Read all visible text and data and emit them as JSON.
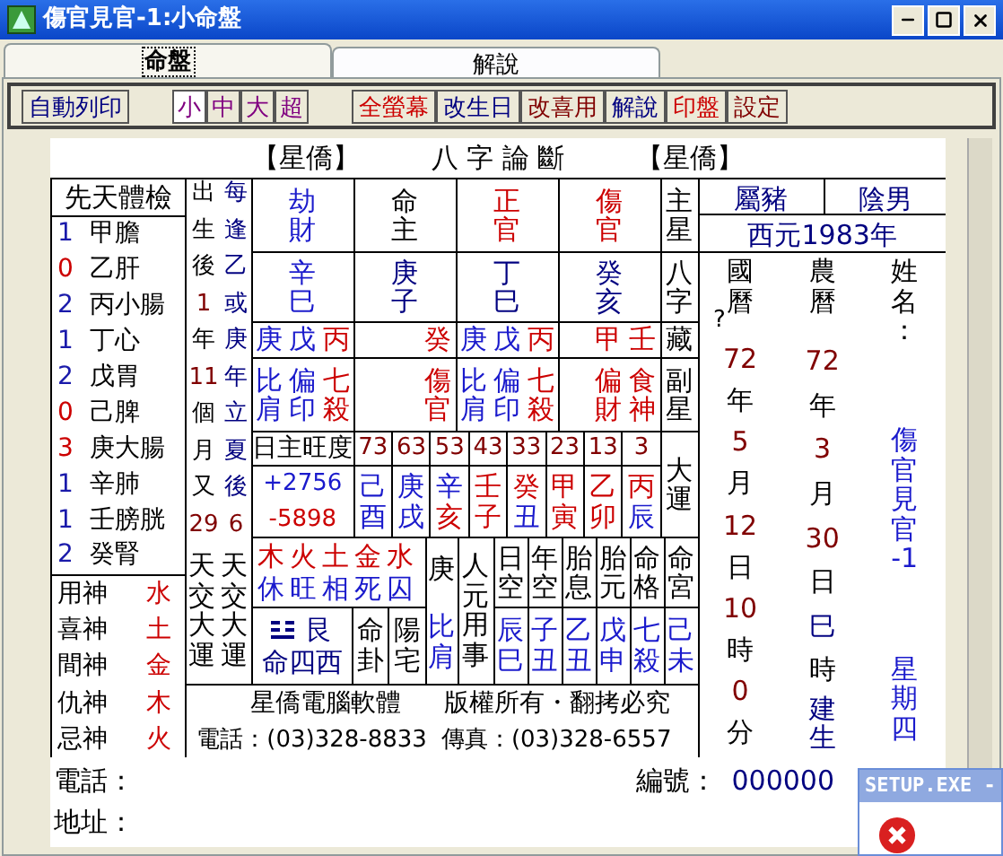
{
  "window": {
    "title": "傷官見官-1:小命盤"
  },
  "tabs": [
    {
      "label": "命盤",
      "selected": true
    },
    {
      "label": "解說",
      "selected": false
    }
  ],
  "toolbar": {
    "print_button": "自動列印",
    "sizes": [
      {
        "label": "小",
        "selected": true
      },
      {
        "label": "中",
        "selected": false
      },
      {
        "label": "大",
        "selected": false
      },
      {
        "label": "超",
        "selected": false
      }
    ],
    "actions": [
      {
        "label": "全螢幕",
        "color": "#cc0000"
      },
      {
        "label": "改生日",
        "color": "#000080"
      },
      {
        "label": "改喜用",
        "color": "#800000"
      },
      {
        "label": "解說",
        "color": "#000080"
      },
      {
        "label": "印盤",
        "color": "#cc0000"
      },
      {
        "label": "設定",
        "color": "#800000"
      }
    ]
  },
  "chart": {
    "heading": {
      "left": "【星僑】",
      "title": "八 字 論 斷",
      "right": "【星僑】"
    },
    "body_check": {
      "title": "先天體檢",
      "organs": [
        {
          "count": "1",
          "color": "#1a1aaa",
          "name": "甲膽"
        },
        {
          "count": "0",
          "color": "#cc0000",
          "name": "乙肝"
        },
        {
          "count": "2",
          "color": "#1a1aaa",
          "name": "丙小腸"
        },
        {
          "count": "1",
          "color": "#1a1aaa",
          "name": "丁心"
        },
        {
          "count": "2",
          "color": "#1a1aaa",
          "name": "戊胃"
        },
        {
          "count": "0",
          "color": "#cc0000",
          "name": "己脾"
        },
        {
          "count": "3",
          "color": "#cc0000",
          "name": "庚大腸"
        },
        {
          "count": "1",
          "color": "#1a1aaa",
          "name": "辛肺"
        },
        {
          "count": "1",
          "color": "#1a1aaa",
          "name": "壬膀胱"
        },
        {
          "count": "2",
          "color": "#1a1aaa",
          "name": "癸腎"
        }
      ]
    },
    "gods": [
      {
        "label": "用神",
        "element": "水"
      },
      {
        "label": "喜神",
        "element": "土"
      },
      {
        "label": "間神",
        "element": "金"
      },
      {
        "label": "仇神",
        "element": "木"
      },
      {
        "label": "忌神",
        "element": "火"
      }
    ],
    "birth_notes": [
      "出生後1年11個月又29",
      "每逢乙或庚年立夏後6"
    ],
    "dayun_notes": [
      "天交大運",
      "天交大運"
    ],
    "row_labels": [
      "主星",
      "八字",
      "藏",
      "副星",
      "大運"
    ],
    "pillars": [
      {
        "star": {
          "text": "劫財",
          "color": "#1a1acc"
        },
        "ganzhi": {
          "text": "辛巳",
          "color": "#1a1acc"
        },
        "hidden": [
          {
            "text": "庚",
            "color": "#1a1acc"
          },
          {
            "text": "戊",
            "color": "#1a1acc"
          },
          {
            "text": "丙",
            "color": "#cc0000"
          }
        ],
        "sub_stars": [
          {
            "text": "比肩",
            "color": "#1a1acc"
          },
          {
            "text": "偏印",
            "color": "#1a1acc"
          },
          {
            "text": "七殺",
            "color": "#cc0000"
          }
        ]
      },
      {
        "star": {
          "text": "命主",
          "color": "#000000"
        },
        "ganzhi": {
          "text": "庚子",
          "color": "#000080"
        },
        "hidden": [
          {
            "text": "癸",
            "color": "#cc0000"
          }
        ],
        "sub_stars": [
          {
            "text": "傷官",
            "color": "#cc0000"
          }
        ]
      },
      {
        "star": {
          "text": "正官",
          "color": "#cc0000"
        },
        "ganzhi": {
          "text": "丁巳",
          "color": "#000080"
        },
        "hidden": [
          {
            "text": "庚",
            "color": "#1a1acc"
          },
          {
            "text": "戊",
            "color": "#1a1acc"
          },
          {
            "text": "丙",
            "color": "#cc0000"
          }
        ],
        "sub_stars": [
          {
            "text": "比肩",
            "color": "#1a1acc"
          },
          {
            "text": "偏印",
            "color": "#1a1acc"
          },
          {
            "text": "七殺",
            "color": "#cc0000"
          }
        ]
      },
      {
        "star": {
          "text": "傷官",
          "color": "#cc0000"
        },
        "ganzhi": {
          "text": "癸亥",
          "color": "#000080"
        },
        "hidden": [
          {
            "text": "甲",
            "color": "#cc0000"
          },
          {
            "text": "壬",
            "color": "#cc0000"
          }
        ],
        "sub_stars": [
          {
            "text": "偏財",
            "color": "#cc0000"
          },
          {
            "text": "食神",
            "color": "#cc0000"
          }
        ]
      }
    ],
    "strength": {
      "label": "日主旺度",
      "plus": "+2756",
      "minus": "-5898"
    },
    "dayun": [
      {
        "age": "73",
        "stem": {
          "text": "己",
          "color": "#1a1acc"
        },
        "branch": {
          "text": "酉",
          "color": "#1a1acc"
        }
      },
      {
        "age": "63",
        "stem": {
          "text": "庚",
          "color": "#1a1acc"
        },
        "branch": {
          "text": "戌",
          "color": "#1a1acc"
        }
      },
      {
        "age": "53",
        "stem": {
          "text": "辛",
          "color": "#1a1acc"
        },
        "branch": {
          "text": "亥",
          "color": "#cc0000"
        }
      },
      {
        "age": "43",
        "stem": {
          "text": "壬",
          "color": "#cc0000"
        },
        "branch": {
          "text": "子",
          "color": "#cc0000"
        }
      },
      {
        "age": "33",
        "stem": {
          "text": "癸",
          "color": "#cc0000"
        },
        "branch": {
          "text": "丑",
          "color": "#1a1acc"
        }
      },
      {
        "age": "23",
        "stem": {
          "text": "甲",
          "color": "#cc0000"
        },
        "branch": {
          "text": "寅",
          "color": "#cc0000"
        }
      },
      {
        "age": "13",
        "stem": {
          "text": "乙",
          "color": "#cc0000"
        },
        "branch": {
          "text": "卯",
          "color": "#cc0000"
        }
      },
      {
        "age": "3",
        "stem": {
          "text": "丙",
          "color": "#cc0000"
        },
        "branch": {
          "text": "辰",
          "color": "#1a1acc"
        }
      }
    ],
    "elements": "木火土金水",
    "element_states": "休旺相死囚",
    "trigram": {
      "name": "艮",
      "group": "命四西",
      "label": "命卦",
      "house": "陽宅"
    },
    "day_stem": {
      "stem": "庚",
      "star": "比肩"
    },
    "ren_yuan": "人元用事",
    "voids": [
      {
        "label": "日空",
        "value": "辰巳"
      },
      {
        "label": "年空",
        "value": "子丑"
      },
      {
        "label": "胎息",
        "value": "乙丑"
      },
      {
        "label": "胎元",
        "value": "戊申"
      },
      {
        "label": "命格",
        "value": "七殺"
      },
      {
        "label": "命宮",
        "value": "己未"
      }
    ],
    "footer": {
      "company": "星僑電腦軟體",
      "rights": "版權所有・翻拷必究",
      "phone": "電話：(03)328-8833",
      "fax": "傳真：(03)328-6557"
    },
    "profile": {
      "zodiac": "屬豬",
      "gender": "陰男",
      "year": "西元1983年",
      "solar": {
        "label": "國曆",
        "mark": "?",
        "parts": [
          [
            "72",
            "年"
          ],
          [
            "5",
            "月"
          ],
          [
            "12",
            "日"
          ],
          [
            "10",
            "時"
          ],
          [
            "0",
            "分"
          ]
        ]
      },
      "lunar": {
        "label": "農曆",
        "parts": [
          [
            "72",
            "年"
          ],
          [
            "3",
            "月"
          ],
          [
            "30",
            "日"
          ],
          [
            "巳",
            "時"
          ]
        ],
        "note": "建生"
      },
      "name_label": "姓名：",
      "name": "傷官見官-1",
      "weekday": "星期四"
    }
  },
  "contact": {
    "phone_label": "電話：",
    "address_label": "地址：",
    "id_label": "編號：",
    "id_value": "000000"
  },
  "dialog": {
    "title": "SETUP.EXE -"
  }
}
